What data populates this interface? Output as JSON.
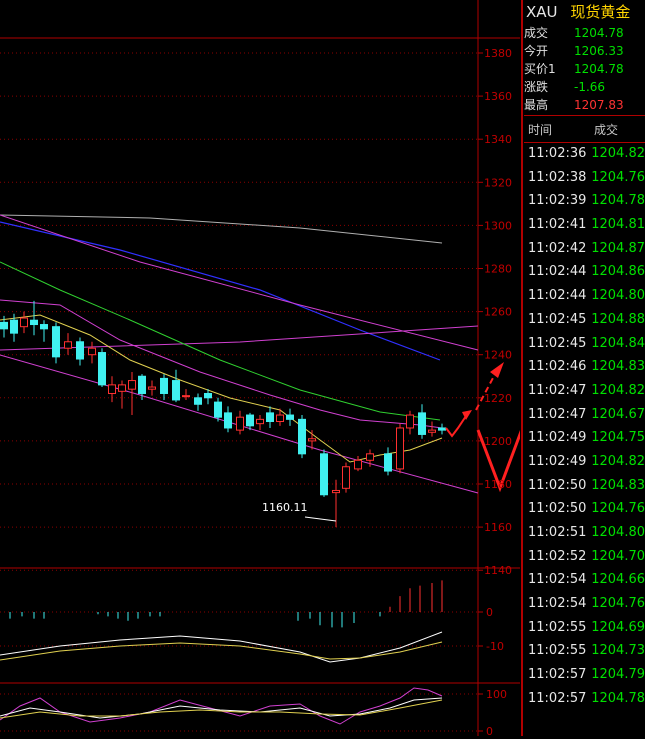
{
  "symbol": "XAU",
  "name": "现货黄金",
  "quote": [
    {
      "label": "成交",
      "value": "1204.78",
      "color": "#00e000"
    },
    {
      "label": "今开",
      "value": "1206.33",
      "color": "#00e000"
    },
    {
      "label": "买价1",
      "value": "1204.78",
      "color": "#00e000"
    },
    {
      "label": "涨跌",
      "value": "-1.66",
      "color": "#00e000"
    },
    {
      "label": "最高",
      "value": "1207.83",
      "color": "#ff3333"
    }
  ],
  "ticks_header": {
    "time": "时间",
    "price": "成交"
  },
  "ticks": [
    {
      "time": "11:02:36",
      "price": "1204.82"
    },
    {
      "time": "11:02:38",
      "price": "1204.76"
    },
    {
      "time": "11:02:39",
      "price": "1204.78"
    },
    {
      "time": "11:02:41",
      "price": "1204.81"
    },
    {
      "time": "11:02:42",
      "price": "1204.87"
    },
    {
      "time": "11:02:44",
      "price": "1204.86"
    },
    {
      "time": "11:02:44",
      "price": "1204.80"
    },
    {
      "time": "11:02:45",
      "price": "1204.88"
    },
    {
      "time": "11:02:45",
      "price": "1204.84"
    },
    {
      "time": "11:02:46",
      "price": "1204.83"
    },
    {
      "time": "11:02:47",
      "price": "1204.82"
    },
    {
      "time": "11:02:47",
      "price": "1204.67"
    },
    {
      "time": "11:02:49",
      "price": "1204.75"
    },
    {
      "time": "11:02:49",
      "price": "1204.82"
    },
    {
      "time": "11:02:50",
      "price": "1204.83"
    },
    {
      "time": "11:02:50",
      "price": "1204.76"
    },
    {
      "time": "11:02:51",
      "price": "1204.80"
    },
    {
      "time": "11:02:52",
      "price": "1204.70"
    },
    {
      "time": "11:02:54",
      "price": "1204.66"
    },
    {
      "time": "11:02:54",
      "price": "1204.76"
    },
    {
      "time": "11:02:55",
      "price": "1204.69"
    },
    {
      "time": "11:02:55",
      "price": "1204.73"
    },
    {
      "time": "11:02:57",
      "price": "1204.79"
    },
    {
      "time": "11:02:57",
      "price": "1204.78"
    }
  ],
  "chart": {
    "price_ticks": [
      "1380",
      "1360",
      "1340",
      "1320",
      "1300",
      "1280",
      "1260",
      "1240",
      "1220",
      "1200",
      "1180",
      "1160",
      "1140"
    ],
    "macd_ticks": [
      "0",
      "-10"
    ],
    "kdj_ticks": [
      "100",
      "0"
    ],
    "low_label": "1160.11",
    "up_color": "#ff3030",
    "down_color": "#40f0f0"
  }
}
